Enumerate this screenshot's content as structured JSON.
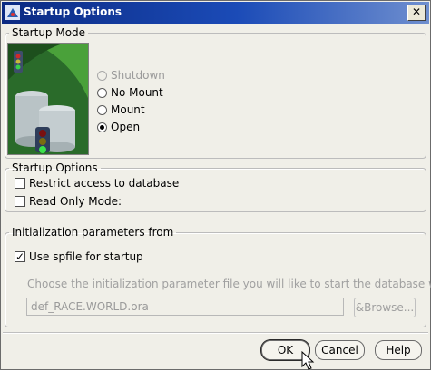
{
  "window": {
    "title": "Startup Options"
  },
  "startup_mode": {
    "legend": "Startup Mode",
    "options": [
      {
        "label": "Shutdown",
        "selected": false,
        "enabled": false
      },
      {
        "label": "No Mount",
        "selected": false,
        "enabled": true
      },
      {
        "label": "Mount",
        "selected": false,
        "enabled": true
      },
      {
        "label": "Open",
        "selected": true,
        "enabled": true
      }
    ]
  },
  "startup_options": {
    "legend": "Startup Options",
    "restrict_label": "Restrict access to database",
    "restrict_checked": false,
    "readonly_label": "Read Only Mode:",
    "readonly_checked": false
  },
  "init_params": {
    "legend": "Initialization parameters from",
    "use_spfile_label": "Use spfile for startup",
    "use_spfile_checked": true,
    "hint": "Choose the initialization parameter file you will like to start the database with",
    "file_value": "def_RACE.WORLD.ora",
    "browse_label": "&Browse..."
  },
  "buttons": {
    "ok": "OK",
    "cancel": "Cancel",
    "help": "Help"
  },
  "colors": {
    "titlebar": "#0b2a82",
    "dialog_bg": "#f0efe8",
    "illustration_green": "#2d7a2d"
  },
  "icons": {
    "title": "oracle-app-icon",
    "close": "close-icon",
    "cursor": "mouse-pointer-icon"
  }
}
